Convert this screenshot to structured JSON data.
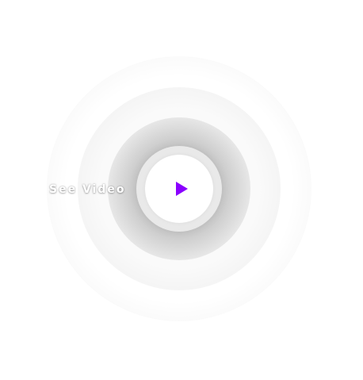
{
  "labels": {
    "see_video": "See Video"
  },
  "icons": {
    "play": "play-icon"
  },
  "colors": {
    "accent": "#8a00ff",
    "background": "#ffffff"
  }
}
